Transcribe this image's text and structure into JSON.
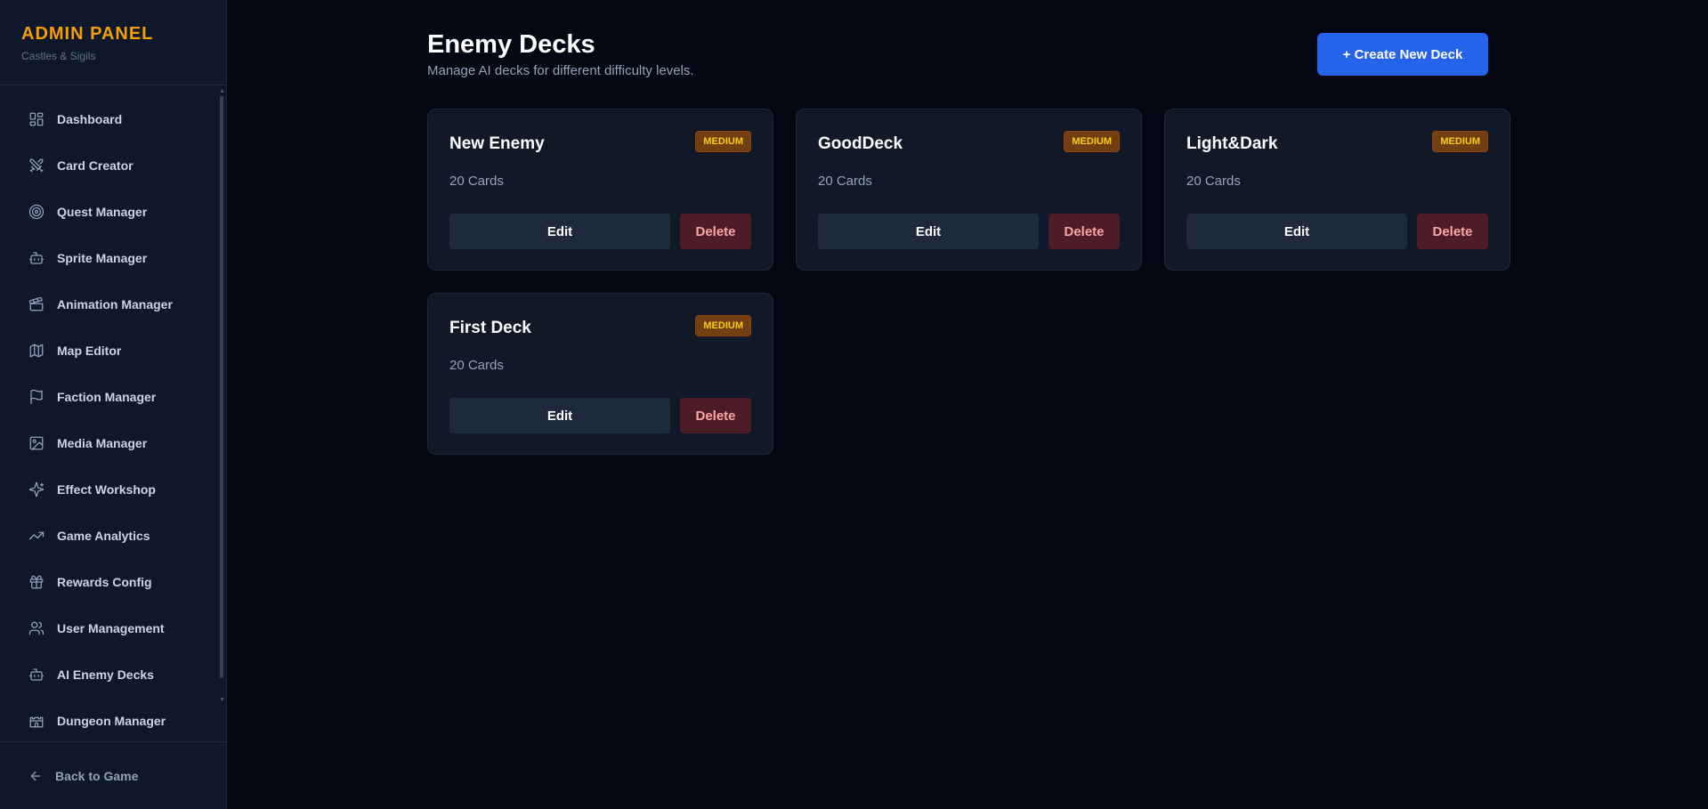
{
  "brand": {
    "title": "ADMIN PANEL",
    "subtitle": "Castles & Sigils"
  },
  "sidebar": {
    "items": [
      {
        "label": "Dashboard",
        "icon": "dashboard-icon"
      },
      {
        "label": "Card Creator",
        "icon": "swords-icon"
      },
      {
        "label": "Quest Manager",
        "icon": "target-icon"
      },
      {
        "label": "Sprite Manager",
        "icon": "bot-icon"
      },
      {
        "label": "Animation Manager",
        "icon": "clapperboard-icon"
      },
      {
        "label": "Map Editor",
        "icon": "map-icon"
      },
      {
        "label": "Faction Manager",
        "icon": "flag-icon"
      },
      {
        "label": "Media Manager",
        "icon": "image-icon"
      },
      {
        "label": "Effect Workshop",
        "icon": "sparkles-icon"
      },
      {
        "label": "Game Analytics",
        "icon": "trending-up-icon"
      },
      {
        "label": "Rewards Config",
        "icon": "gift-icon"
      },
      {
        "label": "User Management",
        "icon": "users-icon"
      },
      {
        "label": "AI Enemy Decks",
        "icon": "bot-icon"
      },
      {
        "label": "Dungeon Manager",
        "icon": "castle-icon"
      }
    ],
    "back_label": "Back to Game"
  },
  "header": {
    "title": "Enemy Decks",
    "subtitle": "Manage AI decks for different difficulty levels.",
    "create_label": "+ Create New Deck"
  },
  "decks": [
    {
      "name": "New Enemy",
      "difficulty": "MEDIUM",
      "count": "20 Cards",
      "edit": "Edit",
      "delete": "Delete"
    },
    {
      "name": "GoodDeck",
      "difficulty": "MEDIUM",
      "count": "20 Cards",
      "edit": "Edit",
      "delete": "Delete"
    },
    {
      "name": "Light&Dark",
      "difficulty": "MEDIUM",
      "count": "20 Cards",
      "edit": "Edit",
      "delete": "Delete"
    },
    {
      "name": "First Deck",
      "difficulty": "MEDIUM",
      "count": "20 Cards",
      "edit": "Edit",
      "delete": "Delete"
    }
  ],
  "colors": {
    "brand": "#f59e0b",
    "primary": "#2563eb",
    "badge_bg": "#713f12",
    "badge_text": "#facc15",
    "danger_bg": "#4c1d27",
    "danger_text": "#fca5a5"
  }
}
